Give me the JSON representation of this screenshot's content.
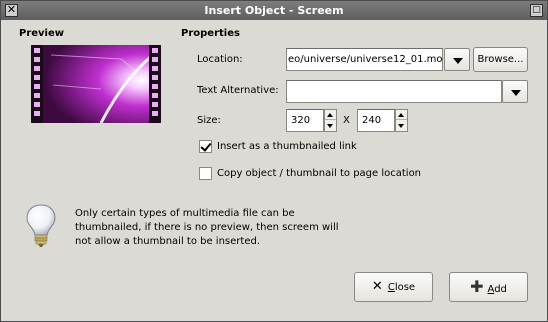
{
  "window": {
    "title": "Insert Object - Screem"
  },
  "titlebar": {
    "close_glyph": "✕",
    "maximize_glyph": "□"
  },
  "preview": {
    "heading": "Preview"
  },
  "properties": {
    "heading": "Properties",
    "location_label": "Location:",
    "location_value": "eo/universe/universe12_01.mov",
    "browse_label": "Browse...",
    "text_alt_label": "Text Alternative:",
    "text_alt_value": "",
    "size_label": "Size:",
    "width_value": "320",
    "size_separator": "X",
    "height_value": "240",
    "thumbnail_link_label": "Insert as a thumbnailed link",
    "thumbnail_link_checked": true,
    "copy_label": "Copy object / thumbnail to page location",
    "copy_checked": false
  },
  "info": {
    "icon": "lightbulb-icon",
    "line1": "Only certain types of multimedia file can be",
    "line2": "thumbnailed, if there is no preview, then screem will",
    "line3": "not allow a thumbnail to be inserted."
  },
  "buttons": {
    "close_label": "Close",
    "close_mnemonic": "C",
    "close_rest": "lose",
    "add_label": "Add",
    "add_mnemonic": "A",
    "add_rest": "dd"
  }
}
